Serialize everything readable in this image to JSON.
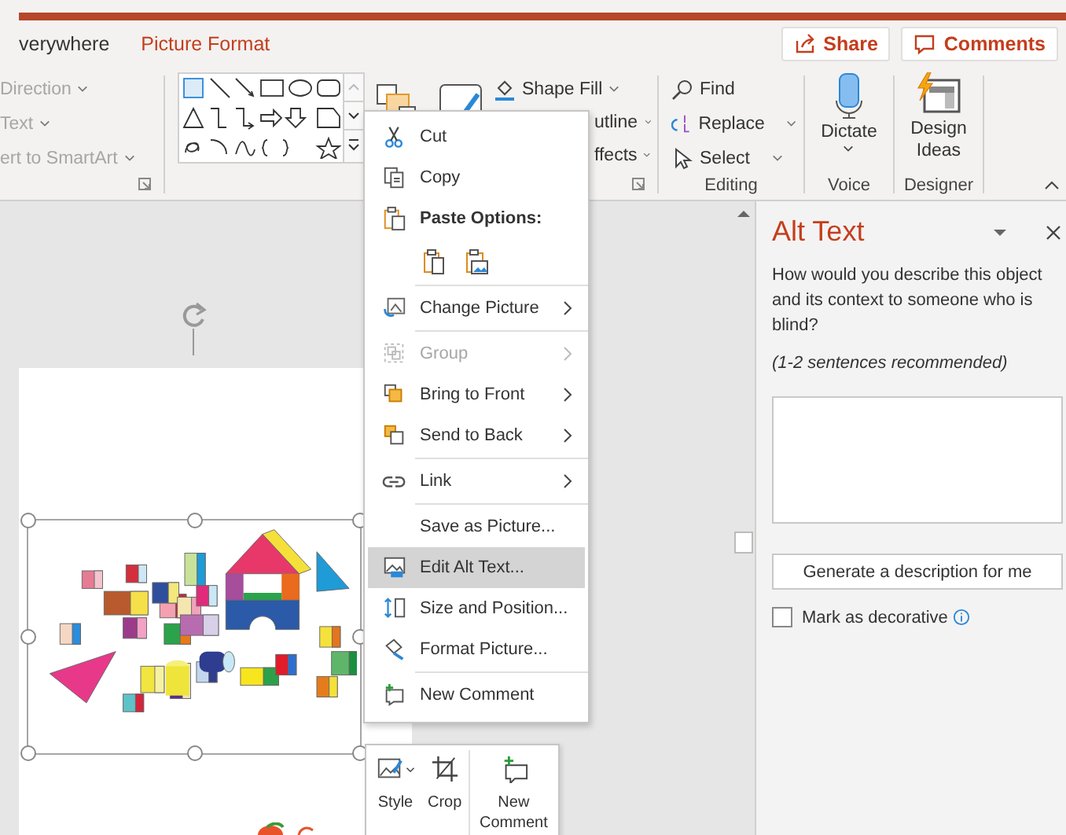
{
  "tabs": [
    {
      "label": "verywhere",
      "selected": false
    },
    {
      "label": "Picture Format",
      "selected": true
    }
  ],
  "header_buttons": [
    {
      "label": "Share"
    },
    {
      "label": "Comments"
    }
  ],
  "ribbon": {
    "text_group": [
      {
        "label": "Direction",
        "disabled": true
      },
      {
        "label": "Text",
        "disabled": true
      },
      {
        "label": "ert to SmartArt",
        "disabled": true
      }
    ],
    "shape_styles": [
      {
        "label": "Shape Fill"
      },
      {
        "label": "utline"
      },
      {
        "label": "ffects"
      }
    ],
    "editing": {
      "items": [
        {
          "label": "Find",
          "dropdown": false
        },
        {
          "label": "Replace",
          "dropdown": true
        },
        {
          "label": "Select",
          "dropdown": true
        }
      ],
      "label": "Editing"
    },
    "voice": {
      "button": "Dictate",
      "label": "Voice"
    },
    "designer": {
      "button_lines": [
        "Design",
        "Ideas"
      ],
      "label": "Designer"
    }
  },
  "context_menu": [
    {
      "kind": "item",
      "label": "Cut",
      "submenu": false,
      "disabled": false,
      "selected": false
    },
    {
      "kind": "item",
      "label": "Copy",
      "submenu": false,
      "disabled": false,
      "selected": false
    },
    {
      "kind": "header",
      "label": "Paste Options:"
    },
    {
      "kind": "paste_icons"
    },
    {
      "kind": "separator"
    },
    {
      "kind": "item",
      "label": "Change Picture",
      "submenu": true,
      "disabled": false,
      "selected": false
    },
    {
      "kind": "separator"
    },
    {
      "kind": "item",
      "label": "Group",
      "submenu": true,
      "disabled": true,
      "selected": false
    },
    {
      "kind": "item",
      "label": "Bring to Front",
      "submenu": true,
      "disabled": false,
      "selected": false
    },
    {
      "kind": "item",
      "label": "Send to Back",
      "submenu": true,
      "disabled": false,
      "selected": false
    },
    {
      "kind": "separator"
    },
    {
      "kind": "item",
      "label": "Link",
      "submenu": true,
      "disabled": false,
      "selected": false
    },
    {
      "kind": "separator"
    },
    {
      "kind": "item",
      "label": "Save as Picture...",
      "submenu": false,
      "disabled": false,
      "selected": false
    },
    {
      "kind": "item",
      "label": "Edit Alt Text...",
      "submenu": false,
      "disabled": false,
      "selected": true
    },
    {
      "kind": "item",
      "label": "Size and Position...",
      "submenu": false,
      "disabled": false,
      "selected": false
    },
    {
      "kind": "item",
      "label": "Format Picture...",
      "submenu": false,
      "disabled": false,
      "selected": false
    },
    {
      "kind": "separator"
    },
    {
      "kind": "item",
      "label": "New Comment",
      "submenu": false,
      "disabled": false,
      "selected": false
    }
  ],
  "mini_toolbar": [
    {
      "label": "Style",
      "dropdown": true
    },
    {
      "label": "Crop",
      "dropdown": false
    },
    {
      "label": "New Comment",
      "dropdown": false
    }
  ],
  "alt_text_pane": {
    "title": "Alt Text",
    "question": "How would you describe this object and its context to someone who is blind?",
    "hint": "(1-2 sentences recommended)",
    "generate_button": "Generate a description for me",
    "decorative": {
      "label": "Mark as decorative",
      "checked": false
    }
  }
}
